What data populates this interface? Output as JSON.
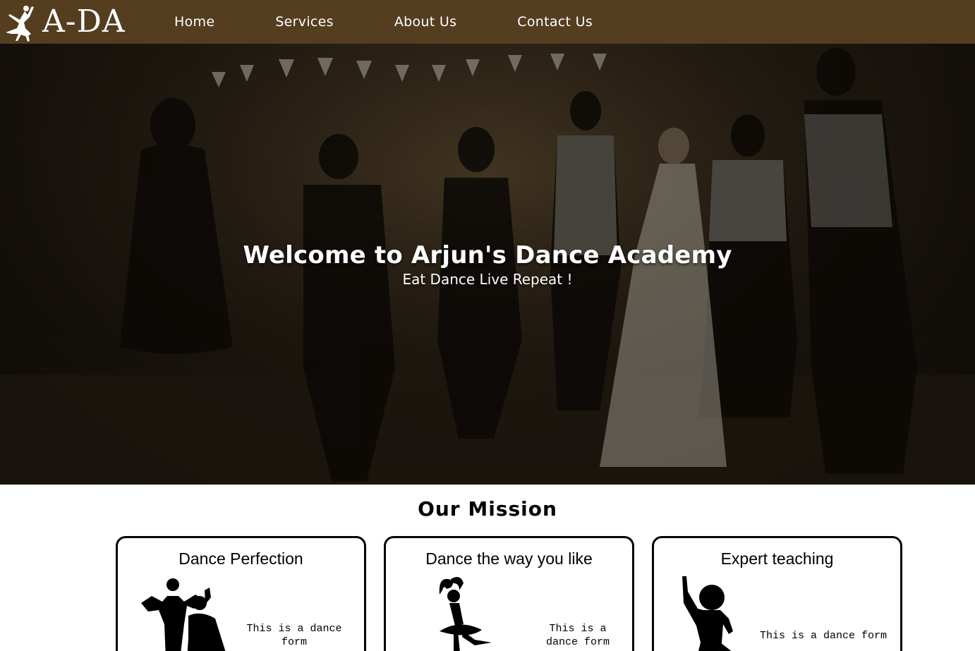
{
  "brand": {
    "name": "A-DA",
    "logo_icon": "dancer-logo-icon"
  },
  "nav": {
    "items": [
      {
        "label": "Home"
      },
      {
        "label": "Services"
      },
      {
        "label": "About Us"
      },
      {
        "label": "Contact Us"
      }
    ]
  },
  "hero": {
    "title": "Welcome to Arjun's Dance Academy",
    "subtitle": "Eat Dance Live Repeat !"
  },
  "mission": {
    "title": "Our Mission",
    "cards": [
      {
        "title": "Dance Perfection",
        "text": "This is a dance form",
        "icon": "dancing-couple-silhouette-icon"
      },
      {
        "title": "Dance the way you like",
        "text": "This is a dance form",
        "icon": "ballerina-silhouette-icon"
      },
      {
        "title": "Expert teaching",
        "text": "This is a dance form",
        "icon": "dancer-silhouette-icon"
      }
    ]
  },
  "colors": {
    "navbar": "#553d20",
    "text_light": "#ffffff",
    "text_dark": "#000000"
  }
}
